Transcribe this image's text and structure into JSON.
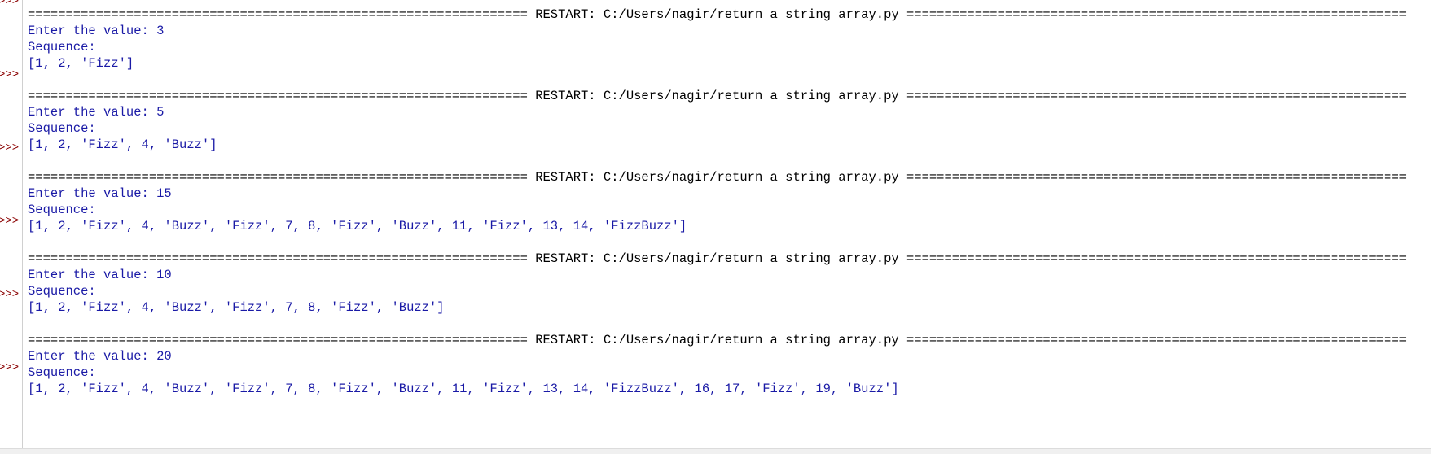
{
  "prompt": ">>>",
  "runs": [
    {
      "restart": "================================================================== RESTART: C:/Users/nagir/return a string array.py ==================================================================",
      "input_line": "Enter the value: 3",
      "sequence_label": "Sequence:",
      "result": "[1, 2, 'Fizz']"
    },
    {
      "restart": "================================================================== RESTART: C:/Users/nagir/return a string array.py ==================================================================",
      "input_line": "Enter the value: 5",
      "sequence_label": "Sequence:",
      "result": "[1, 2, 'Fizz', 4, 'Buzz']"
    },
    {
      "restart": "================================================================== RESTART: C:/Users/nagir/return a string array.py ==================================================================",
      "input_line": "Enter the value: 15",
      "sequence_label": "Sequence:",
      "result": "[1, 2, 'Fizz', 4, 'Buzz', 'Fizz', 7, 8, 'Fizz', 'Buzz', 11, 'Fizz', 13, 14, 'FizzBuzz']"
    },
    {
      "restart": "================================================================== RESTART: C:/Users/nagir/return a string array.py ==================================================================",
      "input_line": "Enter the value: 10",
      "sequence_label": "Sequence:",
      "result": "[1, 2, 'Fizz', 4, 'Buzz', 'Fizz', 7, 8, 'Fizz', 'Buzz']"
    },
    {
      "restart": "================================================================== RESTART: C:/Users/nagir/return a string array.py ==================================================================",
      "input_line": "Enter the value: 20",
      "sequence_label": "Sequence:",
      "result": "[1, 2, 'Fizz', 4, 'Buzz', 'Fizz', 7, 8, 'Fizz', 'Buzz', 11, 'Fizz', 13, 14, 'FizzBuzz', 16, 17, 'Fizz', 19, 'Buzz']"
    }
  ],
  "colors": {
    "prompt": "#8b0000",
    "stdout": "#1a1aa6",
    "restart": "#000000"
  }
}
